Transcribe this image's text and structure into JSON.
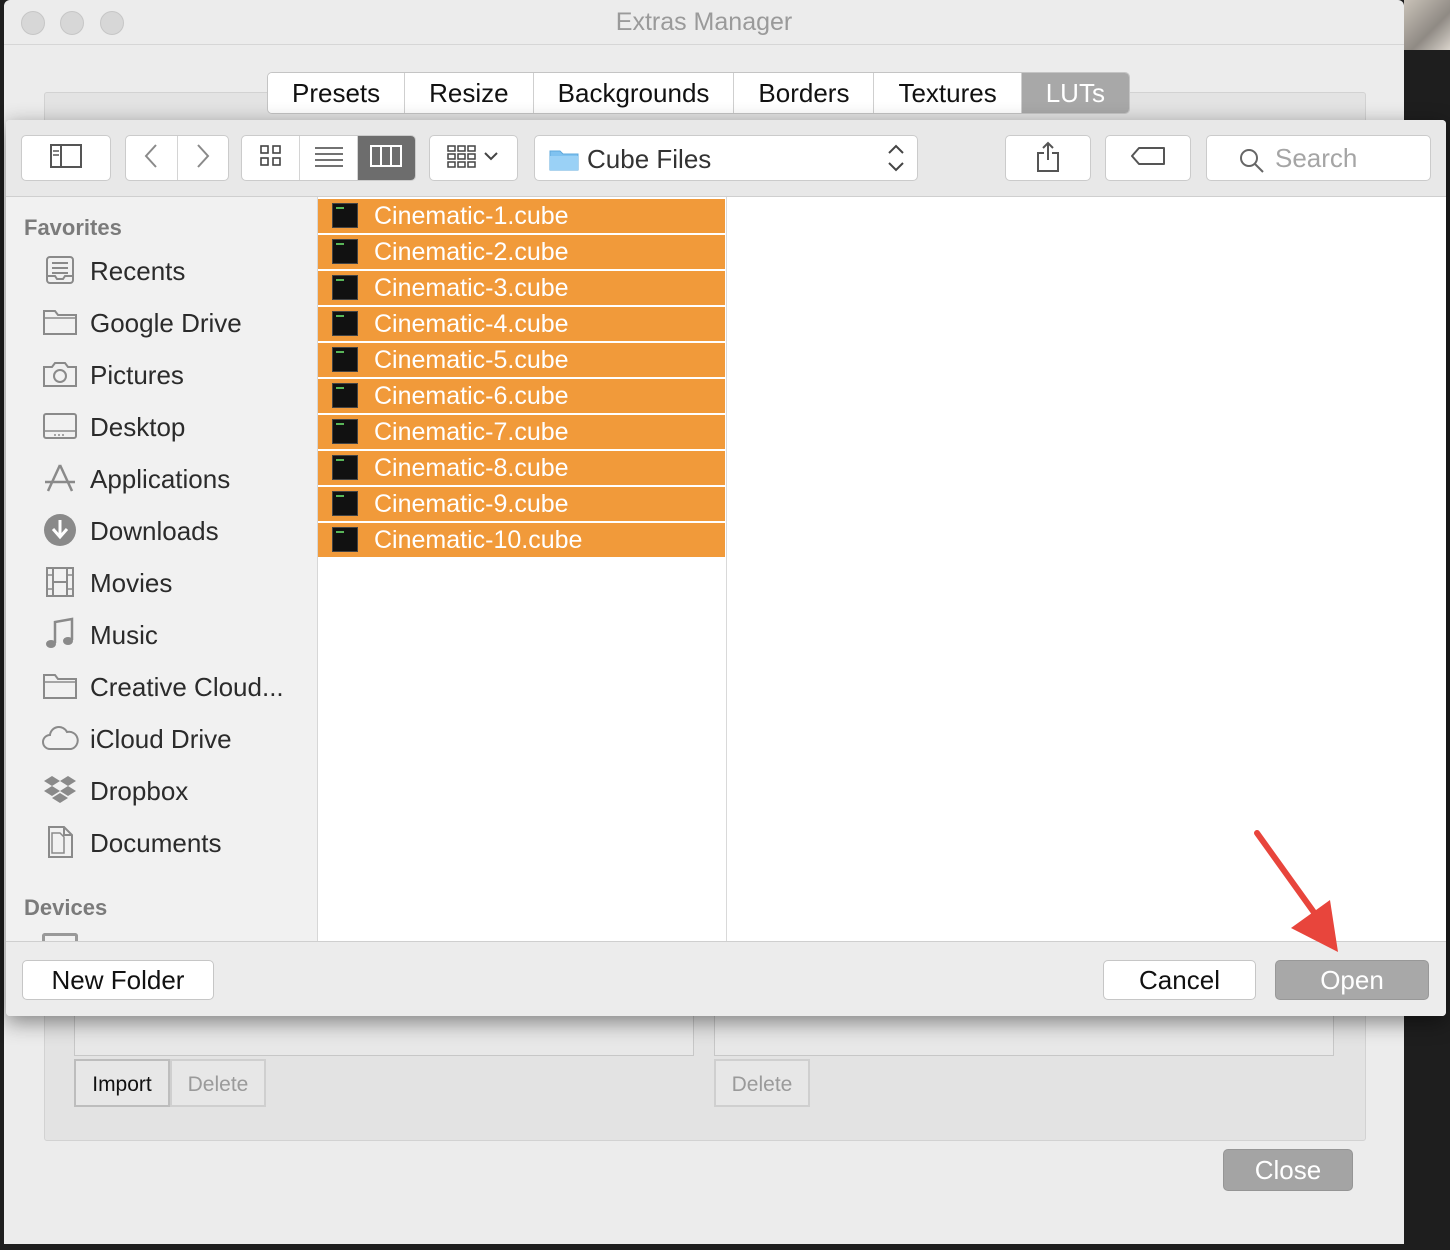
{
  "window": {
    "title": "Extras Manager"
  },
  "tabs": [
    {
      "label": "Presets",
      "active": false
    },
    {
      "label": "Resize",
      "active": false
    },
    {
      "label": "Backgrounds",
      "active": false
    },
    {
      "label": "Borders",
      "active": false
    },
    {
      "label": "Textures",
      "active": false
    },
    {
      "label": "LUTs",
      "active": true
    }
  ],
  "dialog": {
    "toolbar": {
      "location": "Cube Files",
      "search_placeholder": "Search",
      "view_mode": "columns"
    },
    "sidebar": {
      "favorites_heading": "Favorites",
      "devices_heading": "Devices",
      "items": [
        {
          "label": "Recents",
          "icon": "recents-icon"
        },
        {
          "label": "Google Drive",
          "icon": "folder-icon"
        },
        {
          "label": "Pictures",
          "icon": "camera-icon"
        },
        {
          "label": "Desktop",
          "icon": "desktop-icon"
        },
        {
          "label": "Applications",
          "icon": "applications-icon"
        },
        {
          "label": "Downloads",
          "icon": "download-icon"
        },
        {
          "label": "Movies",
          "icon": "film-icon"
        },
        {
          "label": "Music",
          "icon": "music-note-icon"
        },
        {
          "label": "Creative Cloud...",
          "icon": "folder-icon"
        },
        {
          "label": "iCloud Drive",
          "icon": "cloud-icon"
        },
        {
          "label": "Dropbox",
          "icon": "dropbox-icon"
        },
        {
          "label": "Documents",
          "icon": "document-icon"
        }
      ]
    },
    "files": [
      {
        "name": "Cinematic-1.cube",
        "selected": true
      },
      {
        "name": "Cinematic-2.cube",
        "selected": true
      },
      {
        "name": "Cinematic-3.cube",
        "selected": true
      },
      {
        "name": "Cinematic-4.cube",
        "selected": true
      },
      {
        "name": "Cinematic-5.cube",
        "selected": true
      },
      {
        "name": "Cinematic-6.cube",
        "selected": true
      },
      {
        "name": "Cinematic-7.cube",
        "selected": true
      },
      {
        "name": "Cinematic-8.cube",
        "selected": true
      },
      {
        "name": "Cinematic-9.cube",
        "selected": true
      },
      {
        "name": "Cinematic-10.cube",
        "selected": true
      }
    ],
    "buttons": {
      "new_folder": "New Folder",
      "cancel": "Cancel",
      "open": "Open"
    }
  },
  "background_panel": {
    "import": "Import",
    "delete": "Delete",
    "delete_right": "Delete",
    "close": "Close"
  },
  "colors": {
    "selection": "#f19a3a",
    "annotation_arrow": "#e8453c"
  }
}
